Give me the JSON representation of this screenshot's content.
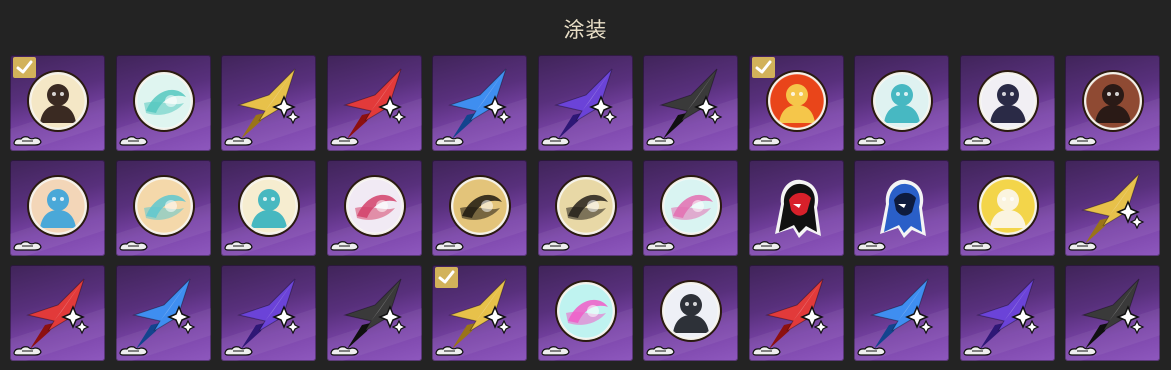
{
  "header": {
    "title": "涂装"
  },
  "colors": {
    "card_gradient": [
      "#402459",
      "#8e58be"
    ],
    "check_badge": "#d2b25a",
    "title_text": "#e9dfc7",
    "background": "#232323"
  },
  "skins": [
    {
      "emblem": "portrait-medallion",
      "palette": [
        "#f4e7c6",
        "#3a2a22"
      ],
      "selected": true
    },
    {
      "emblem": "swirl-medallion",
      "palette": [
        "#dff5f0",
        "#55c8c0"
      ],
      "selected": false
    },
    {
      "emblem": "star-logo",
      "palette": [
        "#e7c14a",
        "#9a7418"
      ],
      "selected": false
    },
    {
      "emblem": "star-logo",
      "palette": [
        "#e23a3a",
        "#8d1010"
      ],
      "selected": false
    },
    {
      "emblem": "star-logo",
      "palette": [
        "#3f8ef0",
        "#13448e"
      ],
      "selected": false
    },
    {
      "emblem": "star-logo",
      "palette": [
        "#6b43d8",
        "#2e1776"
      ],
      "selected": false
    },
    {
      "emblem": "star-logo",
      "palette": [
        "#3a3a3a",
        "#101010"
      ],
      "selected": false
    },
    {
      "emblem": "portrait-medallion",
      "palette": [
        "#e9451a",
        "#f5c64a"
      ],
      "selected": true
    },
    {
      "emblem": "portrait-medallion",
      "palette": [
        "#dff2f1",
        "#47b8c2"
      ],
      "selected": false
    },
    {
      "emblem": "portrait-medallion",
      "palette": [
        "#f1eff4",
        "#2a2a46"
      ],
      "selected": false
    },
    {
      "emblem": "portrait-medallion",
      "palette": [
        "#8f4a33",
        "#2a1a16"
      ],
      "selected": false
    },
    {
      "emblem": "portrait-medallion",
      "palette": [
        "#f3d6b8",
        "#4aa8d8"
      ],
      "selected": false
    },
    {
      "emblem": "swirl-medallion",
      "palette": [
        "#f4d8aa",
        "#5ec8d0"
      ],
      "selected": false
    },
    {
      "emblem": "portrait-medallion",
      "palette": [
        "#f6edd0",
        "#47b8c0"
      ],
      "selected": false
    },
    {
      "emblem": "swirl-medallion",
      "palette": [
        "#f1eaf4",
        "#d4416a"
      ],
      "selected": false
    },
    {
      "emblem": "swirl-medallion",
      "palette": [
        "#e3c47a",
        "#1f1a10"
      ],
      "selected": false
    },
    {
      "emblem": "swirl-medallion",
      "palette": [
        "#e8d8a6",
        "#25201a"
      ],
      "selected": false
    },
    {
      "emblem": "swirl-medallion",
      "palette": [
        "#d9f4f2",
        "#e36fb2"
      ],
      "selected": false
    },
    {
      "emblem": "silhouette",
      "palette": [
        "#111111",
        "#d8202a"
      ],
      "selected": false
    },
    {
      "emblem": "silhouette",
      "palette": [
        "#2a5fc8",
        "#0e1b3e"
      ],
      "selected": false
    },
    {
      "emblem": "portrait-medallion",
      "palette": [
        "#f3d54a",
        "#fbf4df"
      ],
      "selected": false
    },
    {
      "emblem": "star-logo",
      "palette": [
        "#e7c14a",
        "#9a7418"
      ],
      "selected": false
    },
    {
      "emblem": "star-logo",
      "palette": [
        "#e23a3a",
        "#8d1010"
      ],
      "selected": false
    },
    {
      "emblem": "star-logo",
      "palette": [
        "#3f8ef0",
        "#13448e"
      ],
      "selected": false
    },
    {
      "emblem": "star-logo",
      "palette": [
        "#6b43d8",
        "#2e1776"
      ],
      "selected": false
    },
    {
      "emblem": "star-logo",
      "palette": [
        "#3a3a3a",
        "#101010"
      ],
      "selected": false
    },
    {
      "emblem": "star-logo",
      "palette": [
        "#e7c14a",
        "#9a7418"
      ],
      "selected": true
    },
    {
      "emblem": "swirl-medallion",
      "palette": [
        "#bff3f0",
        "#f05cc8"
      ],
      "selected": false
    },
    {
      "emblem": "portrait-medallion",
      "palette": [
        "#eef0f6",
        "#2d3138"
      ],
      "selected": false
    },
    {
      "emblem": "star-logo",
      "palette": [
        "#e23a3a",
        "#8d1010"
      ],
      "selected": false
    },
    {
      "emblem": "star-logo",
      "palette": [
        "#3f8ef0",
        "#13448e"
      ],
      "selected": false
    },
    {
      "emblem": "star-logo",
      "palette": [
        "#6b43d8",
        "#2e1776"
      ],
      "selected": false
    },
    {
      "emblem": "star-logo",
      "palette": [
        "#3a3a3a",
        "#101010"
      ],
      "selected": false
    }
  ]
}
